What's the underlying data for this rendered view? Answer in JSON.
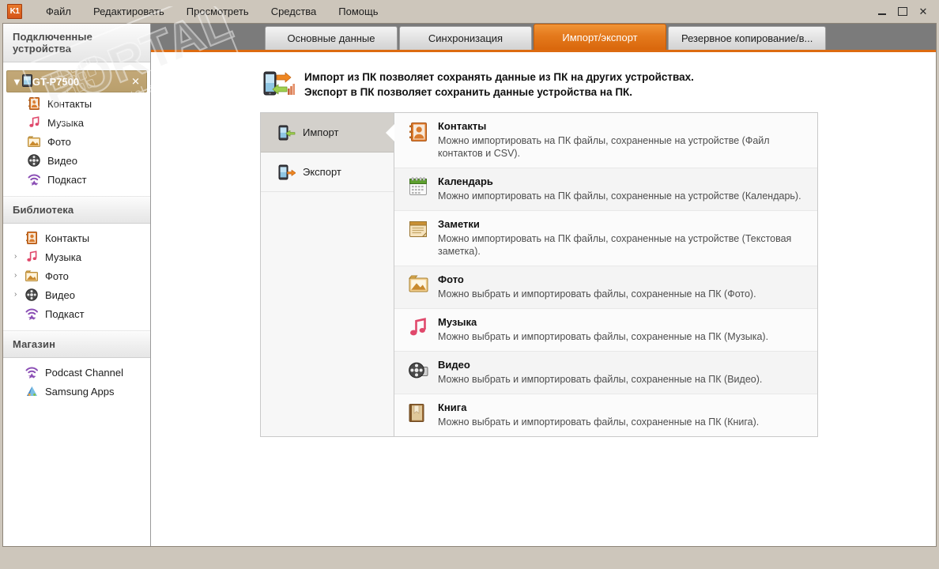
{
  "window": {
    "logo_text": "K1",
    "controls": {
      "minimize": "minimize-icon",
      "maximize": "maximize-icon",
      "close": "✕"
    }
  },
  "menubar": {
    "items": [
      {
        "label": "Файл",
        "name": "menu-file"
      },
      {
        "label": "Редактировать",
        "name": "menu-edit"
      },
      {
        "label": "Просмотреть",
        "name": "menu-view"
      },
      {
        "label": "Средства",
        "name": "menu-tools"
      },
      {
        "label": "Помощь",
        "name": "menu-help"
      }
    ]
  },
  "sidebar": {
    "sections": [
      {
        "header": "Подключенные устройства",
        "name": "connected-devices"
      },
      {
        "header": "Библиотека",
        "name": "library"
      },
      {
        "header": "Магазин",
        "name": "store"
      }
    ],
    "device": {
      "label": "GT-P7500",
      "expanded": true,
      "close_glyph": "✕",
      "twisty": "▼",
      "highlight_color": "#bda069",
      "children": [
        {
          "label": "Контакты",
          "icon": "contacts-icon"
        },
        {
          "label": "Музыка",
          "icon": "music-icon"
        },
        {
          "label": "Фото",
          "icon": "photo-icon"
        },
        {
          "label": "Видео",
          "icon": "video-icon"
        },
        {
          "label": "Подкаст",
          "icon": "podcast-icon"
        }
      ]
    },
    "library_items": [
      {
        "label": "Контакты",
        "icon": "contacts-icon",
        "twisty": ""
      },
      {
        "label": "Музыка",
        "icon": "music-icon",
        "twisty": "›"
      },
      {
        "label": "Фото",
        "icon": "photo-icon",
        "twisty": "›"
      },
      {
        "label": "Видео",
        "icon": "video-icon",
        "twisty": "›"
      },
      {
        "label": "Подкаст",
        "icon": "podcast-icon",
        "twisty": ""
      }
    ],
    "store_items": [
      {
        "label": "Podcast Channel",
        "icon": "podcast-icon",
        "twisty": ""
      },
      {
        "label": "Samsung Apps",
        "icon": "samsung-apps-icon",
        "twisty": ""
      }
    ]
  },
  "tabs": [
    {
      "label": "Основные данные",
      "name": "tab-basic-data",
      "active": false
    },
    {
      "label": "Синхронизация",
      "name": "tab-sync",
      "active": false
    },
    {
      "label": "Импорт/экспорт",
      "name": "tab-import-export",
      "active": true
    },
    {
      "label": "Резервное копирование/в...",
      "name": "tab-backup-restore",
      "active": false
    }
  ],
  "intro": {
    "line1": "Импорт из ПК позволяет сохранять данные из ПК на других устройствах.",
    "line2": "Экспорт в ПК позволяет сохранить данные устройства на ПК."
  },
  "modes": [
    {
      "label": "Импорт",
      "name": "mode-import",
      "active": true
    },
    {
      "label": "Экспорт",
      "name": "mode-export",
      "active": false
    }
  ],
  "items": [
    {
      "title": "Контакты",
      "desc": "Можно импортировать на ПК файлы, сохраненные на устройстве (Файл контактов и CSV).",
      "icon": "contacts-icon"
    },
    {
      "title": "Календарь",
      "desc": "Можно импортировать на ПК файлы, сохраненные на устройстве (Календарь).",
      "icon": "calendar-icon"
    },
    {
      "title": "Заметки",
      "desc": "Можно импортировать на ПК файлы, сохраненные на устройстве (Текстовая заметка).",
      "icon": "notes-icon"
    },
    {
      "title": "Фото",
      "desc": "Можно выбрать и импортировать файлы, сохраненные на ПК (Фото).",
      "icon": "photo-icon"
    },
    {
      "title": "Музыка",
      "desc": "Можно выбрать и импортировать файлы, сохраненные на ПК (Музыка).",
      "icon": "music-icon"
    },
    {
      "title": "Видео",
      "desc": "Можно выбрать и импортировать файлы, сохраненные на ПК (Видео).",
      "icon": "video-icon"
    },
    {
      "title": "Книга",
      "desc": "Можно выбрать и импортировать файлы, сохраненные на ПК (Книга).",
      "icon": "book-icon"
    }
  ],
  "watermark": {
    "big_text": "PORTAL",
    "url_text": "www.softportal.com"
  },
  "colors": {
    "accent_orange": "#dd6b10",
    "tab_strip_gray": "#7b7b7b",
    "window_chrome": "#cdc6bb",
    "device_highlight": "#bda069"
  }
}
